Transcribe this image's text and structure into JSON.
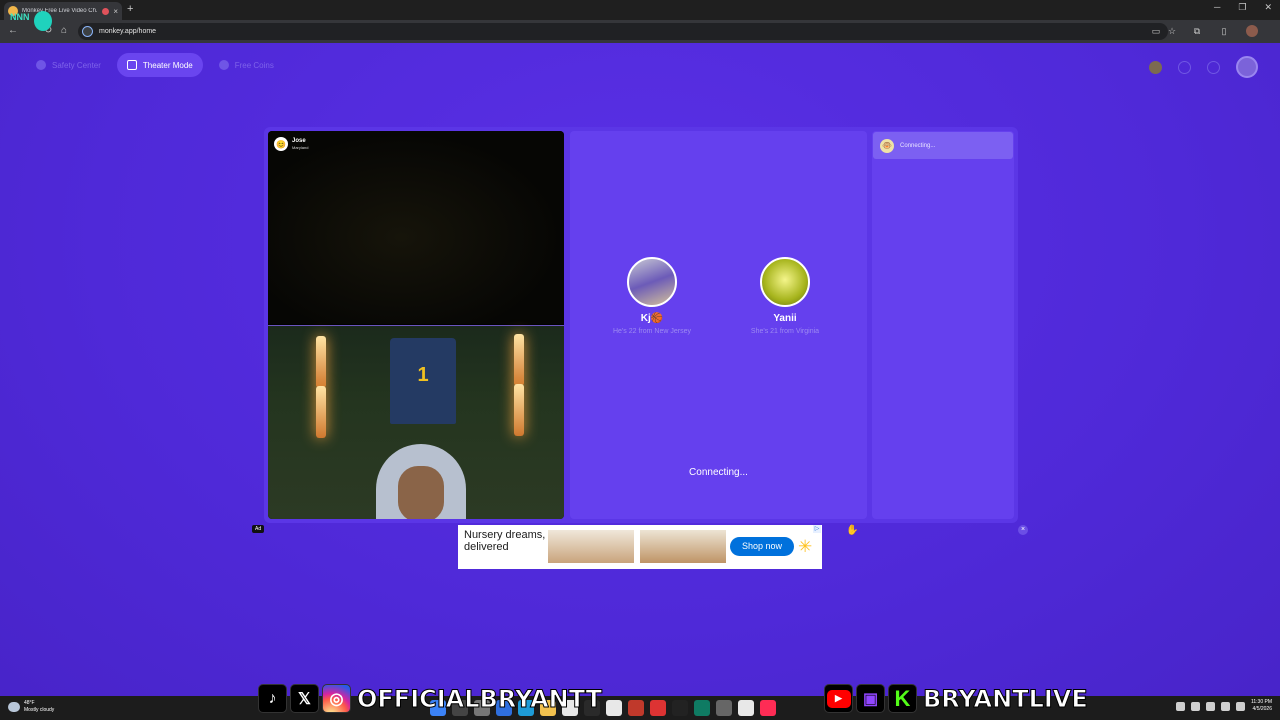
{
  "browser": {
    "tab_title": "Monkey Free Live Video Ch...",
    "tab_close": "×",
    "new_tab": "+",
    "url": "monkey.app/home",
    "window_controls": [
      "─",
      "❐",
      "✕"
    ]
  },
  "nav": {
    "items": [
      {
        "label": "Safety Center",
        "icon": "shield-icon",
        "active": false
      },
      {
        "label": "Theater Mode",
        "icon": "expand-icon",
        "active": true
      },
      {
        "label": "Free Coins",
        "icon": "gift-icon",
        "active": false
      }
    ]
  },
  "video": {
    "caller_name": "Jose",
    "caller_location": "Maryland",
    "jersey_number": "1"
  },
  "match": {
    "profiles": [
      {
        "name": "Kj🏀",
        "detail": "He's 22 from New Jersey"
      },
      {
        "name": "Yanii",
        "detail": "She's 21 from Virginia"
      }
    ],
    "status": "Connecting..."
  },
  "chat": {
    "status": "Connecting..."
  },
  "ad": {
    "label": "Ad",
    "headline": "Nursery dreams, delivered",
    "cta": "Shop now",
    "close": "×"
  },
  "taskbar": {
    "temp": "48°F",
    "condition": "Mostly cloudy",
    "time": "11:30 PM",
    "date": "4/5/2026"
  },
  "overlay": {
    "handle_left": "OFFICIALBRYANTT",
    "handle_right": "BRYANTLIVE"
  },
  "colors": {
    "page_bg": "#5130dd",
    "panel": "#6540ee",
    "accent_blue": "#0071dc"
  }
}
